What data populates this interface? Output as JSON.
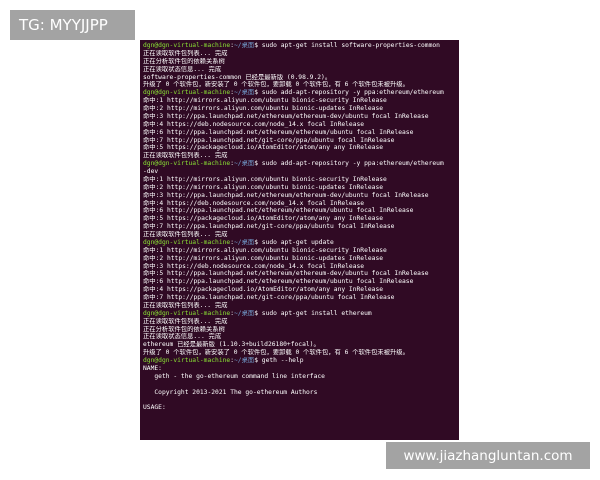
{
  "watermark_top": "TG: MYYJJPP",
  "watermark_bottom": "www.jiazhangluntan.com",
  "terminal": {
    "user_host": "dgn@dgn-virtual-machine",
    "path": "~/桌面",
    "lines": [
      {
        "type": "prompt",
        "cmd": "sudo apt-get install software-properties-common"
      },
      {
        "type": "out",
        "text": "正在读取软件包列表... 完成"
      },
      {
        "type": "out",
        "text": "正在分析软件包的依赖关系树"
      },
      {
        "type": "out",
        "text": "正在读取状态信息... 完成"
      },
      {
        "type": "out",
        "text": "software-properties-common 已经是最新版 (0.98.9.2)。"
      },
      {
        "type": "out",
        "text": "升级了 0 个软件包，新安装了 0 个软件包，要卸载 0 个软件包，有 6 个软件包未被升级。"
      },
      {
        "type": "prompt",
        "cmd": "sudo add-apt-repository -y ppa:ethereum/ethereum"
      },
      {
        "type": "out",
        "text": "命中:1 http://mirrors.aliyun.com/ubuntu bionic-security InRelease"
      },
      {
        "type": "out",
        "text": "命中:2 http://mirrors.aliyun.com/ubuntu bionic-updates InRelease"
      },
      {
        "type": "out",
        "text": "命中:3 http://ppa.launchpad.net/ethereum/ethereum-dev/ubuntu focal InRelease"
      },
      {
        "type": "out",
        "text": "命中:4 https://deb.nodesource.com/node_14.x focal InRelease"
      },
      {
        "type": "out",
        "text": "命中:6 http://ppa.launchpad.net/ethereum/ethereum/ubuntu focal InRelease"
      },
      {
        "type": "out",
        "text": "命中:7 http://ppa.launchpad.net/git-core/ppa/ubuntu focal InRelease"
      },
      {
        "type": "out",
        "text": "命中:5 https://packagecloud.io/AtomEditor/atom/any any InRelease"
      },
      {
        "type": "out",
        "text": "正在读取软件包列表... 完成"
      },
      {
        "type": "prompt",
        "cmd": "sudo add-apt-repository -y ppa:ethereum/ethereum"
      },
      {
        "type": "out",
        "text": "-dev"
      },
      {
        "type": "out",
        "text": "命中:1 http://mirrors.aliyun.com/ubuntu bionic-security InRelease"
      },
      {
        "type": "out",
        "text": "命中:2 http://mirrors.aliyun.com/ubuntu bionic-updates InRelease"
      },
      {
        "type": "out",
        "text": "命中:3 http://ppa.launchpad.net/ethereum/ethereum-dev/ubuntu focal InRelease"
      },
      {
        "type": "out",
        "text": "命中:4 https://deb.nodesource.com/node_14.x focal InRelease"
      },
      {
        "type": "out",
        "text": "命中:6 http://ppa.launchpad.net/ethereum/ethereum/ubuntu focal InRelease"
      },
      {
        "type": "out",
        "text": "命中:5 https://packagecloud.io/AtomEditor/atom/any any InRelease"
      },
      {
        "type": "out",
        "text": "命中:7 http://ppa.launchpad.net/git-core/ppa/ubuntu focal InRelease"
      },
      {
        "type": "out",
        "text": "正在读取软件包列表... 完成"
      },
      {
        "type": "prompt",
        "cmd": "sudo apt-get update"
      },
      {
        "type": "out",
        "text": "命中:1 http://mirrors.aliyun.com/ubuntu bionic-security InRelease"
      },
      {
        "type": "out",
        "text": "命中:2 http://mirrors.aliyun.com/ubuntu bionic-updates InRelease"
      },
      {
        "type": "out",
        "text": "命中:3 https://deb.nodesource.com/node_14.x focal InRelease"
      },
      {
        "type": "out",
        "text": "命中:5 http://ppa.launchpad.net/ethereum/ethereum-dev/ubuntu focal InRelease"
      },
      {
        "type": "out",
        "text": "命中:6 http://ppa.launchpad.net/ethereum/ethereum/ubuntu focal InRelease"
      },
      {
        "type": "out",
        "text": "命中:4 https://packagecloud.io/AtomEditor/atom/any any InRelease"
      },
      {
        "type": "out",
        "text": "命中:7 http://ppa.launchpad.net/git-core/ppa/ubuntu focal InRelease"
      },
      {
        "type": "out",
        "text": "正在读取软件包列表... 完成"
      },
      {
        "type": "prompt",
        "cmd": "sudo apt-get install ethereum"
      },
      {
        "type": "out",
        "text": "正在读取软件包列表... 完成"
      },
      {
        "type": "out",
        "text": "正在分析软件包的依赖关系树"
      },
      {
        "type": "out",
        "text": "正在读取状态信息... 完成"
      },
      {
        "type": "out",
        "text": "ethereum 已经是最新版 (1.10.3+build26180+focal)。"
      },
      {
        "type": "out",
        "text": "升级了 0 个软件包，新安装了 0 个软件包，要卸载 0 个软件包，有 6 个软件包未被升级。"
      },
      {
        "type": "prompt",
        "cmd": "geth --help"
      },
      {
        "type": "out",
        "text": "NAME:"
      },
      {
        "type": "out",
        "text": "   geth - the go-ethereum command line interface"
      },
      {
        "type": "out",
        "text": ""
      },
      {
        "type": "out",
        "text": "   Copyright 2013-2021 The go-ethereum Authors"
      },
      {
        "type": "out",
        "text": ""
      },
      {
        "type": "out",
        "text": "USAGE:"
      }
    ]
  },
  "colors": {
    "terminal_bg": "#300a24",
    "prompt_user": "#8ae234",
    "prompt_path": "#729fcf",
    "watermark_bg": "#a3a3a3"
  }
}
